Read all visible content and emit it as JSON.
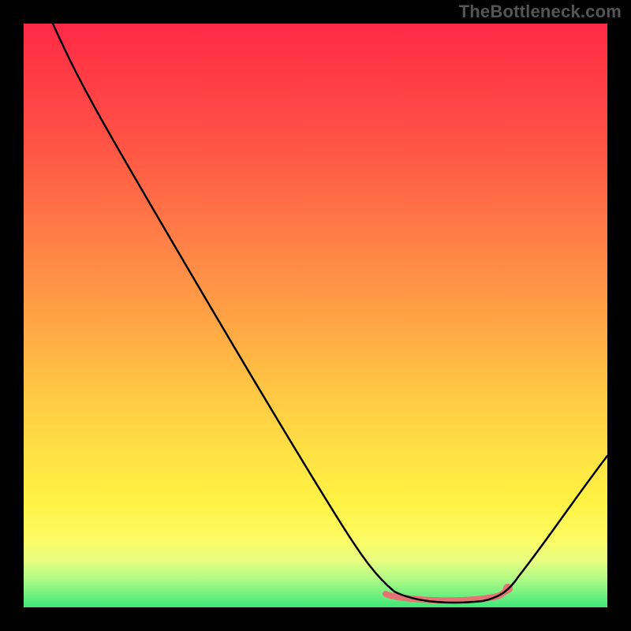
{
  "watermark_text": "TheBottleneck.com",
  "chart_data": {
    "type": "line",
    "title": "",
    "xlabel": "",
    "ylabel": "",
    "xlim": [
      0,
      100
    ],
    "ylim": [
      0,
      100
    ],
    "grid": false,
    "legend": false,
    "axes_visible": false,
    "background_gradient": {
      "direction": "vertical",
      "stops": [
        {
          "pos": 0,
          "color": "#ff2a47"
        },
        {
          "pos": 50,
          "color": "#ffa245"
        },
        {
          "pos": 85,
          "color": "#fdfb61"
        },
        {
          "pos": 100,
          "color": "#3fe77a"
        }
      ]
    },
    "series": [
      {
        "name": "bottleneck-curve",
        "x": [
          5,
          10,
          15,
          20,
          25,
          30,
          35,
          40,
          45,
          50,
          55,
          60,
          62,
          65,
          70,
          75,
          80,
          83,
          85,
          90,
          95,
          100
        ],
        "y": [
          100,
          94,
          86,
          78,
          69,
          60,
          51,
          42,
          33,
          25,
          16,
          9,
          6,
          3,
          1,
          0.5,
          0.5,
          1.5,
          3,
          9,
          17,
          26
        ],
        "_note": "y is visual height from bottom as percent of plot; x is horizontal percent. Curve descends steeply from top-left, bottoms near x≈70–80 at y≈0, rises to ≈26 at right edge."
      }
    ],
    "highlight": {
      "name": "optimal-band",
      "x_range": [
        62,
        83
      ],
      "y_approx": 1.5,
      "color": "#E57373",
      "end_dot_x": 83
    }
  }
}
